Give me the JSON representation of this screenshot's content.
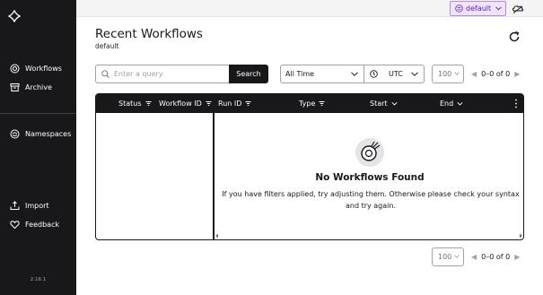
{
  "sidebar": {
    "items": [
      {
        "label": "Workflows",
        "icon": "workflows-icon"
      },
      {
        "label": "Archive",
        "icon": "archive-icon"
      },
      {
        "label": "Namespaces",
        "icon": "namespaces-icon"
      },
      {
        "label": "Import",
        "icon": "import-icon"
      },
      {
        "label": "Feedback",
        "icon": "heart-icon"
      }
    ],
    "version": "2.16.1"
  },
  "topbar": {
    "namespace": "default"
  },
  "main": {
    "title": "Recent Workflows",
    "subtitle": "default"
  },
  "search": {
    "placeholder": "Enter a query",
    "button_label": "Search"
  },
  "filters": {
    "time_range": "All Time",
    "timezone": "UTC"
  },
  "pagination": {
    "page_size": "100",
    "range": "0–0 of 0"
  },
  "table": {
    "columns": [
      "Status",
      "Workflow ID",
      "Run ID",
      "Type",
      "Start",
      "End"
    ],
    "empty_title": "No Workflows Found",
    "empty_message": "If you have filters applied, try adjusting them. Otherwise please check your syntax and try again."
  },
  "colors": {
    "sidebar_bg": "#18181b",
    "accent": "#b38af0",
    "namespace_bg": "#efe4fb"
  }
}
